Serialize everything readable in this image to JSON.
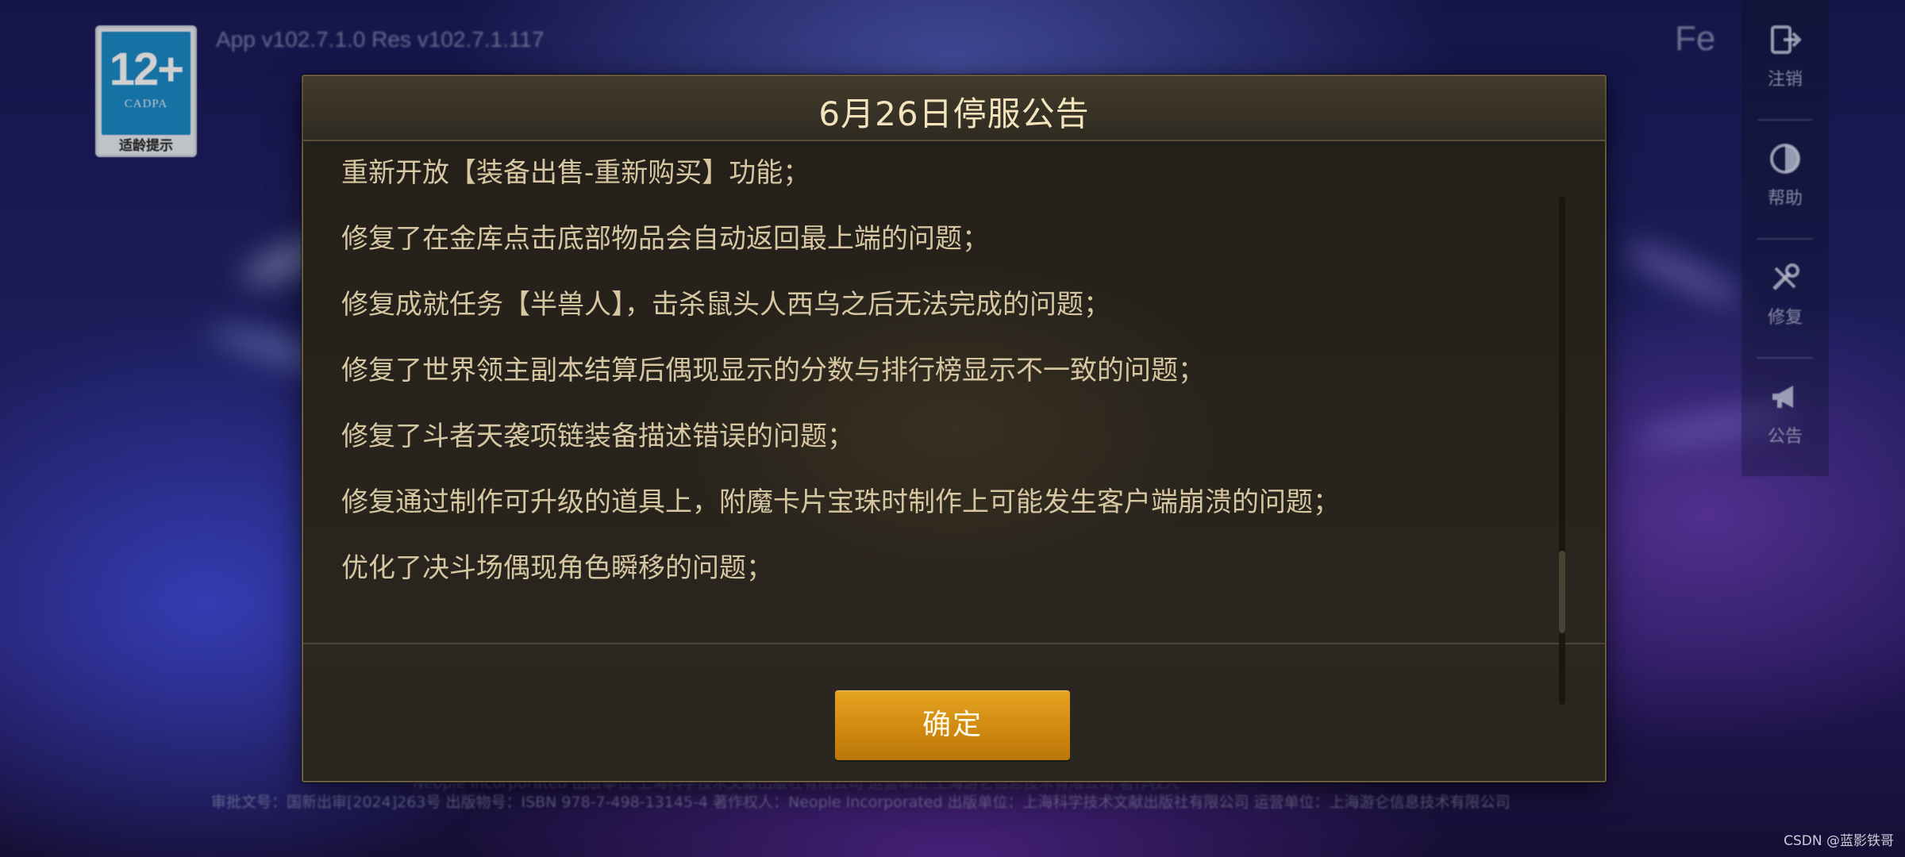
{
  "background": {
    "version_text": "App v102.7.1.0 Res v102.7.1.117",
    "corner_text": "Fe",
    "age_rating": {
      "label": "12+",
      "org": "CADPA",
      "caption": "适龄提示",
      "color": "#1c8ac9"
    },
    "side_menu": [
      {
        "label": "注销",
        "icon": "logout-icon"
      },
      {
        "label": "帮助",
        "icon": "help-icon"
      },
      {
        "label": "修复",
        "icon": "repair-icon"
      },
      {
        "label": "公告",
        "icon": "announcement-icon"
      }
    ],
    "footer_upper": "Neople Incorporated 出版单位 上海科学技术文献出版社有限公司 运营单位 上海游仑信息技术有限公司 著作权人",
    "footer": "审批文号：国新出审[2024]263号 出版物号：ISBN 978-7-498-13145-4 著作权人：Neople Incorporated 出版单位：上海科学技术文献出版社有限公司 运营单位：上海游仑信息技术有限公司",
    "watermark": "CSDN @蓝影铁哥"
  },
  "dialog": {
    "title": "6月26日停服公告",
    "notes": [
      "重新开放【装备出售-重新购买】功能；",
      "修复了在金库点击底部物品会自动返回最上端的问题；",
      "修复成就任务【半兽人】，击杀鼠头人西乌之后无法完成的问题；",
      "修复了世界领主副本结算后偶现显示的分数与排行榜显示不一致的问题；",
      "修复了斗者天袭项链装备描述错误的问题；",
      "修复通过制作可升级的道具上，附魔卡片宝珠时制作上可能发生客户端崩溃的问题；",
      "优化了决斗场偶现角色瞬移的问题；"
    ],
    "confirm_label": "确定",
    "scroll_position": 0.77,
    "colors": {
      "accent": "#d08a10",
      "title_text": "#f3e4bd",
      "body_text": "#d7c6a2"
    }
  }
}
